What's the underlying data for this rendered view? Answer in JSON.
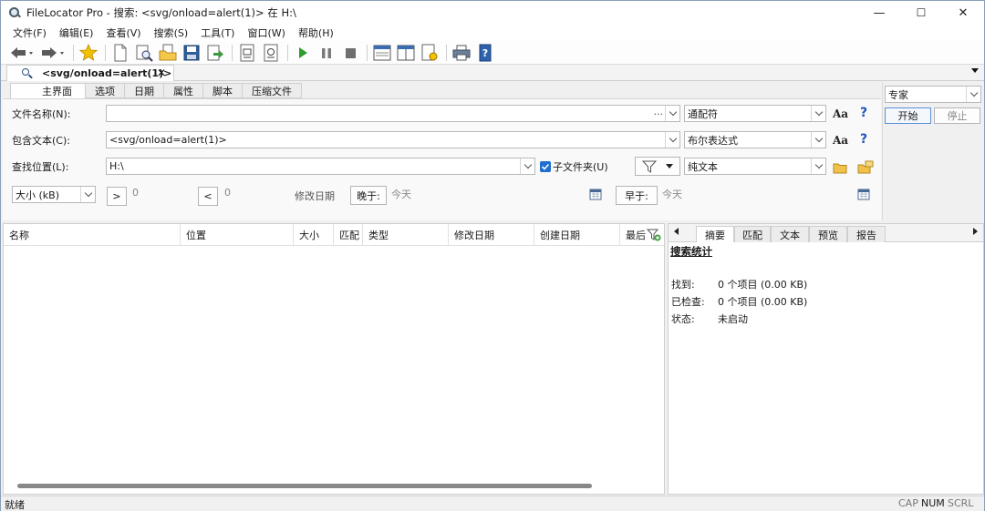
{
  "window": {
    "title": "FileLocator Pro - 搜索: <svg/onload=alert(1)> 在 H:\\",
    "minimize": "—",
    "maximize": "☐",
    "close": "✕"
  },
  "menu": [
    "文件(F)",
    "编辑(E)",
    "查看(V)",
    "搜索(S)",
    "工具(T)",
    "窗口(W)",
    "帮助(H)"
  ],
  "query_tab": {
    "label": "<svg/onload=alert(1)>",
    "close": "✕"
  },
  "criteria_tabs": [
    "主界面",
    "选项",
    "日期",
    "属性",
    "脚本",
    "压缩文件"
  ],
  "criteria": {
    "filename_label": "文件名称(N):",
    "filename_value": "",
    "filename_dots": "...",
    "filename_mode": "通配符",
    "content_label": "包含文本(C):",
    "content_value": "<svg/onload=alert(1)>",
    "content_mode": "布尔表达式",
    "location_label": "查找位置(L):",
    "location_value": "H:\\",
    "subfolder_label": "子文件夹(U)",
    "subfolder_checked": true,
    "location_mode": "纯文本",
    "aa": "Aa",
    "help": "?",
    "size_select": "大小 (kB)",
    "gt": ">",
    "gt_value": "0",
    "lt": "<",
    "lt_value": "0",
    "modified_label": "修改日期",
    "later_btn": "晚于:",
    "later_value": "今天",
    "earlier_btn": "早于:",
    "earlier_value": "今天"
  },
  "right_panel": {
    "mode_select": "专家",
    "start_btn": "开始",
    "stop_btn": "停止"
  },
  "results": {
    "columns": [
      "名称",
      "位置",
      "大小",
      "匹配",
      "类型",
      "修改日期",
      "创建日期",
      "最后"
    ]
  },
  "side_panel": {
    "tabs": [
      "摘要",
      "匹配",
      "文本",
      "预览",
      "报告"
    ],
    "heading": "搜索统计",
    "rows": [
      {
        "label": "找到:",
        "value": "0 个项目 (0.00 KB)"
      },
      {
        "label": "已检查:",
        "value": "0 个项目 (0.00 KB)"
      },
      {
        "label": "状态:",
        "value": "未启动"
      }
    ]
  },
  "status": {
    "left": "就绪",
    "cap": "CAP",
    "num": "NUM",
    "scrl": "SCRL"
  }
}
